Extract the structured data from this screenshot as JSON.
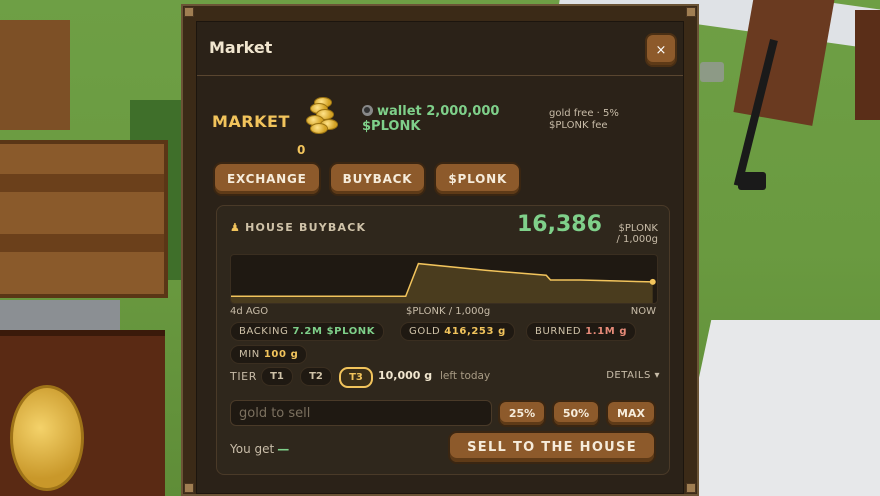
{
  "dialog": {
    "title": "Market",
    "close_label": "×"
  },
  "market": {
    "heading": "MARKET",
    "coin_count": "0",
    "wallet_text": "wallet 2,000,000 $PLONK",
    "fee_text": "gold free · 5% $PLONK fee"
  },
  "tabs": [
    {
      "label": "EXCHANGE"
    },
    {
      "label": "BUYBACK"
    },
    {
      "label": "$PLONK"
    }
  ],
  "buyback": {
    "heading": "HOUSE BUYBACK",
    "price": "16,386",
    "price_unit_1": "$PLONK",
    "price_unit_2": "/ 1,000g",
    "chart_data": {
      "type": "area",
      "x_start_label": "4d AGO",
      "x_mid_label": "$PLONK / 1,000g",
      "x_end_label": "NOW",
      "x": [
        0,
        0.41,
        0.44,
        0.6,
        0.74,
        0.75,
        0.82,
        0.9,
        0.99
      ],
      "y": [
        0.14,
        0.14,
        0.82,
        0.68,
        0.58,
        0.48,
        0.48,
        0.46,
        0.44
      ],
      "color": "#f2c45c"
    },
    "stats": {
      "backing_label": "BACKING",
      "backing_value": "7.2M $PLONK",
      "gold_label": "GOLD",
      "gold_value": "416,253 g",
      "burned_label": "BURNED",
      "burned_value": "1.1M g",
      "min_label": "MIN",
      "min_value": "100 g"
    },
    "tier": {
      "label": "TIER",
      "options": [
        "T1",
        "T2",
        "T3"
      ],
      "selected": "T3",
      "amount": "10,000 g",
      "left_text": "left today",
      "details_label": "DETAILS ▾"
    },
    "input": {
      "placeholder": "gold to sell",
      "value": ""
    },
    "quick": [
      "25%",
      "50%",
      "MAX"
    ],
    "you_get_label": "You get",
    "you_get_value": "—",
    "sell_label": "SELL TO THE HOUSE"
  },
  "colors": {
    "accent_gold": "#f2c45c",
    "accent_green": "#7fd08a",
    "button_brown": "#8d5a2b"
  }
}
